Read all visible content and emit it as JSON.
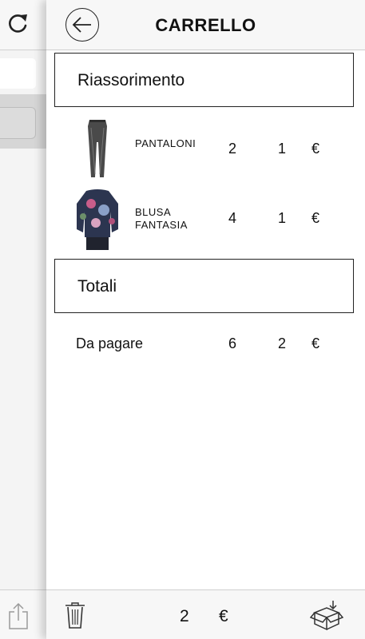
{
  "header": {
    "title": "CARRELLO"
  },
  "sections": {
    "items_title": "Riassorimento",
    "totals_title": "Totali"
  },
  "items": [
    {
      "name_line1": "PANTALONI",
      "name_line2": "",
      "qty": "2",
      "price": "1",
      "currency": "€",
      "image": "trousers-photo"
    },
    {
      "name_line1": "BLUSA",
      "name_line2": "FANTASIA",
      "qty": "4",
      "price": "1",
      "currency": "€",
      "image": "floral-blouse-photo"
    }
  ],
  "totals": {
    "label": "Da pagare",
    "qty": "6",
    "price": "2",
    "currency": "€"
  },
  "toolbar": {
    "sum": "2",
    "currency": "€"
  },
  "icons": {
    "back": "back-arrow-circle-icon",
    "refresh": "refresh-icon",
    "share": "share-icon",
    "trash": "trash-icon",
    "checkout": "box-download-icon"
  }
}
